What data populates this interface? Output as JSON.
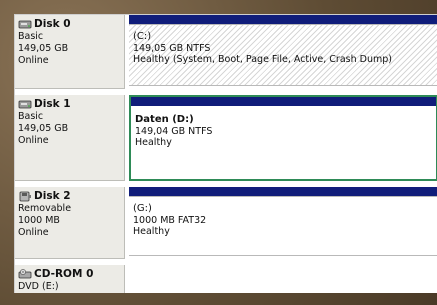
{
  "disks": [
    {
      "name": "Disk 0",
      "type": "Basic",
      "size": "149,05 GB",
      "status": "Online",
      "icon": "hard-disk-icon",
      "partition": {
        "label": "(C:)",
        "size_fs": "149,05 GB NTFS",
        "health": "Healthy (System, Boot, Page File, Active, Crash Dump)"
      }
    },
    {
      "name": "Disk 1",
      "type": "Basic",
      "size": "149,05 GB",
      "status": "Online",
      "icon": "hard-disk-icon",
      "partition": {
        "label": "Daten  (D:)",
        "size_fs": "149,04 GB NTFS",
        "health": "Healthy"
      }
    },
    {
      "name": "Disk 2",
      "type": "Removable",
      "size": "1000 MB",
      "status": "Online",
      "icon": "removable-disk-icon",
      "partition": {
        "label": "(G:)",
        "size_fs": "1000 MB FAT32",
        "health": "Healthy"
      }
    }
  ],
  "cdrom": {
    "name": "CD-ROM 0",
    "type": "DVD (E:)",
    "icon": "cdrom-drive-icon"
  },
  "colors": {
    "partition_bar": "#101d7a",
    "selected_border": "#2e8b57",
    "info_bg": "#ecebe6"
  }
}
